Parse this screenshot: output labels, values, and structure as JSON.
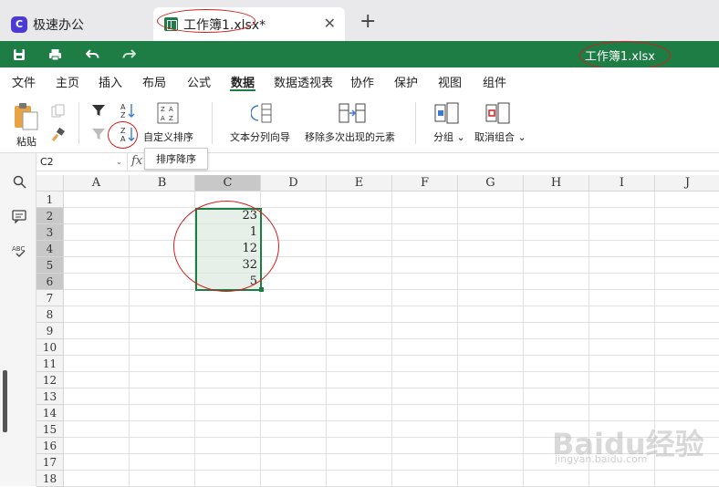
{
  "tabs": [
    {
      "label": "极速办公"
    },
    {
      "label": "工作簿1.xlsx*"
    }
  ],
  "quick": {
    "doc_title": "工作簿1.xlsx"
  },
  "menu": [
    "文件",
    "主页",
    "插入",
    "布局",
    "公式",
    "数据",
    "数据透视表",
    "协作",
    "保护",
    "视图",
    "组件"
  ],
  "active_menu": "数据",
  "ribbon": {
    "paste": "粘贴",
    "custom_sort": "自定义排序",
    "text_split": "文本分列向导",
    "remove_dup": "移除多次出现的元素",
    "group": "分组",
    "ungroup": "取消组合",
    "tooltip": "排序降序"
  },
  "formula": {
    "namebox": "C2",
    "fx": "fx",
    "value": ""
  },
  "columns": [
    "A",
    "B",
    "C",
    "D",
    "E",
    "F",
    "G",
    "H",
    "I",
    "J"
  ],
  "rows": [
    "1",
    "2",
    "3",
    "4",
    "5",
    "6",
    "7",
    "8",
    "9",
    "10",
    "11",
    "12",
    "13",
    "14",
    "15",
    "16",
    "17",
    "18"
  ],
  "cells": {
    "C2": "23",
    "C3": "1",
    "C4": "12",
    "C5": "32",
    "C6": "5"
  },
  "watermark": {
    "main": "Baidu经验",
    "sub": "jingyan.baidu.com"
  },
  "colors": {
    "brand_green": "#1e7c45",
    "annotation_red": "#d21e1e"
  }
}
